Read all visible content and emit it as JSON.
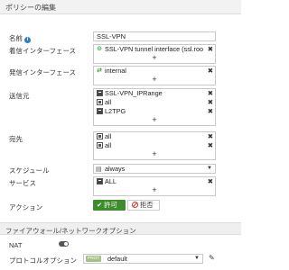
{
  "page_title": "ポリシーの編集",
  "fields": {
    "name": {
      "label": "名前",
      "value": "SSL-VPN"
    },
    "incoming_interface": {
      "label": "着信インターフェース",
      "items": [
        "SSL-VPN tunnel interface (ssl.roo"
      ]
    },
    "outgoing_interface": {
      "label": "発信インターフェース",
      "items": [
        "internal"
      ]
    },
    "source": {
      "label": "送信元",
      "items": [
        "SSL-VPN_IPRange",
        "all",
        "L2TPG"
      ]
    },
    "destination": {
      "label": "宛先",
      "items": [
        "all",
        "all"
      ]
    },
    "schedule": {
      "label": "スケジュール",
      "value": "always"
    },
    "service": {
      "label": "サービス",
      "items": [
        "ALL"
      ]
    },
    "action": {
      "label": "アクション",
      "accept_label": "許可",
      "deny_label": "拒否"
    }
  },
  "firewall_section": {
    "title": "ファイアウォール/ネットワークオプション",
    "nat_label": "NAT",
    "protocol_option_label": "プロトコルオプション",
    "protocol_badge": "PROT",
    "protocol_value": "default"
  },
  "add_symbol": "+",
  "remove_symbol": "✖",
  "colors": {
    "accept_green": "#3e8c2c",
    "deny_red": "#c0392b",
    "info_blue": "#2d7fc1"
  }
}
